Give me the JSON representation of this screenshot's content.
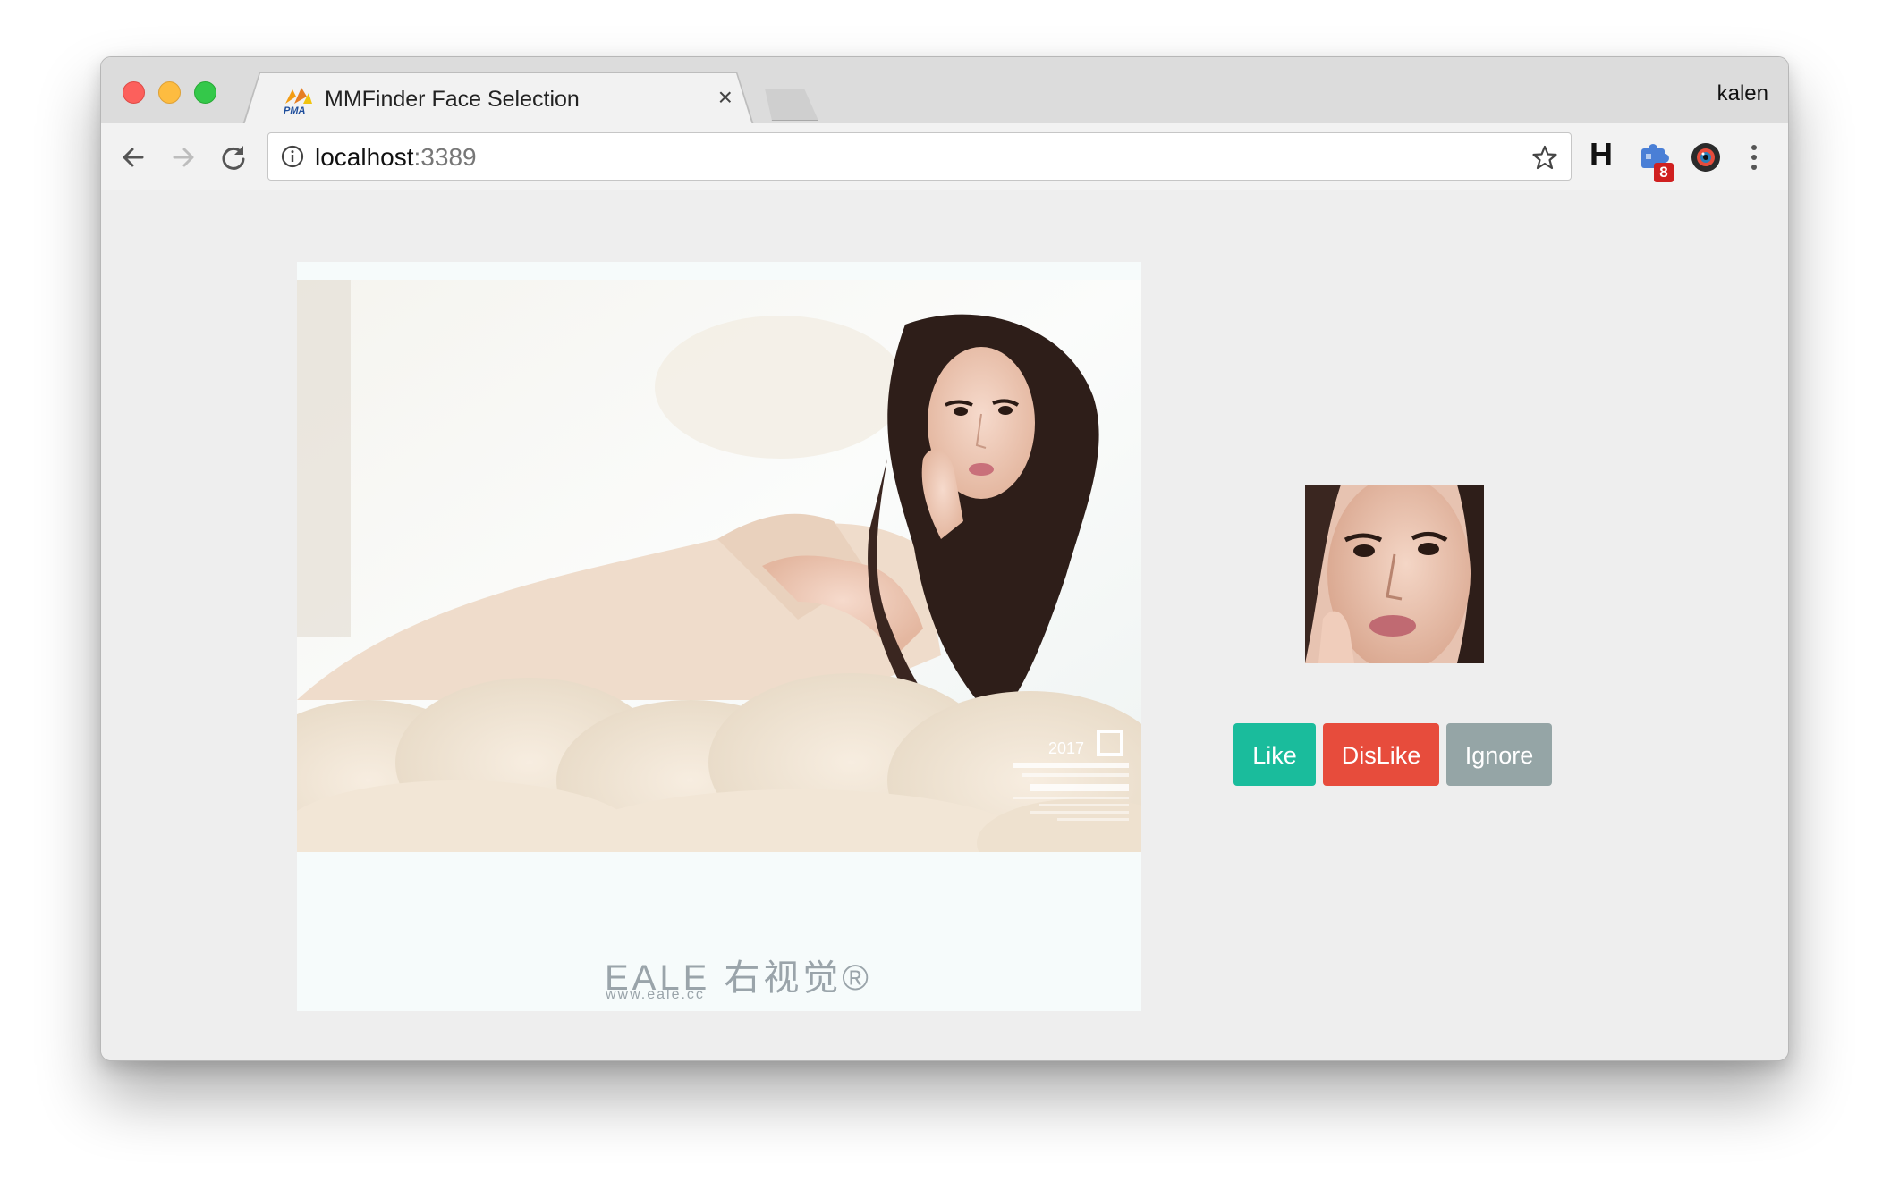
{
  "browser": {
    "tab": {
      "title": "MMFinder Face Selection",
      "favicon": "pma-logo-icon",
      "close_glyph": "×"
    },
    "profile_name": "kalen",
    "address": {
      "host": "localhost",
      "port": ":3389"
    },
    "extensions": {
      "h_label": "H",
      "badge_count": "8"
    }
  },
  "page": {
    "main_image": {
      "description_icon": "portrait-photo",
      "watermark_logo": "EALE 右视觉®",
      "watermark_url": "www.eale.cc",
      "corner_year": "2017"
    },
    "face_crop": {
      "icon": "face-crop-image"
    },
    "actions": {
      "like_label": "Like",
      "dislike_label": "DisLike",
      "ignore_label": "Ignore"
    }
  },
  "colors": {
    "like": "#1abc9c",
    "dislike": "#e74c3c",
    "ignore": "#95a5a6",
    "page_bg": "#eeeeee"
  }
}
